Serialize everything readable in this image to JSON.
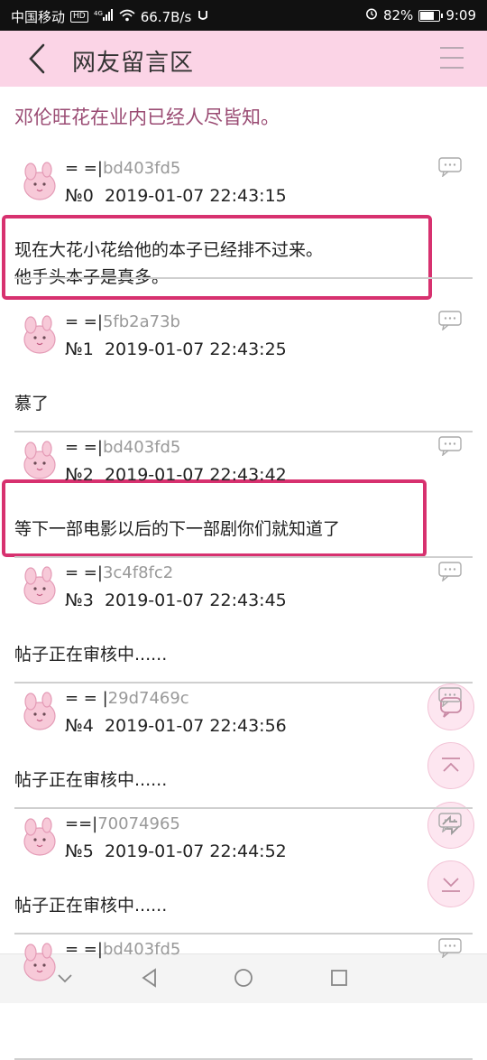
{
  "status_bar": {
    "carrier": "中国移动",
    "hd": "HD",
    "signal": "4G",
    "speed": "66.7B/s",
    "battery_pct": "82%",
    "battery_level": 0.82,
    "time": "9:09"
  },
  "header": {
    "title": "网友留言区"
  },
  "topic": "邓伦旺花在业内已经人尽皆知。",
  "posts": [
    {
      "user_prefix": "= =|",
      "user_hash": "bd403fd5",
      "floor": "№0",
      "timestamp": "2019-01-07 22:43:15",
      "body": "现在大花小花给他的本子已经排不过来。\n他手头本子是真多。"
    },
    {
      "user_prefix": "= =|",
      "user_hash": "5fb2a73b",
      "floor": "№1",
      "timestamp": "2019-01-07 22:43:25",
      "body": "慕了"
    },
    {
      "user_prefix": "= =|",
      "user_hash": "bd403fd5",
      "floor": "№2",
      "timestamp": "2019-01-07 22:43:42",
      "body": "等下一部电影以后的下一部剧你们就知道了"
    },
    {
      "user_prefix": "= =|",
      "user_hash": "3c4f8fc2",
      "floor": "№3",
      "timestamp": "2019-01-07 22:43:45",
      "body": "帖子正在审核中......"
    },
    {
      "user_prefix": "= = |",
      "user_hash": "29d7469c",
      "floor": "№4",
      "timestamp": "2019-01-07 22:43:56",
      "body": "帖子正在审核中......"
    },
    {
      "user_prefix": "==|",
      "user_hash": "70074965",
      "floor": "№5",
      "timestamp": "2019-01-07 22:44:52",
      "body": "帖子正在审核中......"
    },
    {
      "user_prefix": "= =|",
      "user_hash": "bd403fd5",
      "floor": "",
      "timestamp": "",
      "body": ""
    }
  ],
  "colors": {
    "header_bg": "#fbd4e6",
    "topic_text": "#9a4b73",
    "highlight": "#d7316f",
    "fab_bg": "#fde6f0"
  },
  "icons": {
    "back": "chevron-left-icon",
    "menu": "hamburger-menu-icon",
    "reply": "comment-bubble-icon",
    "fab_comment": "comment-icon",
    "fab_top": "scroll-top-icon",
    "fab_refresh": "refresh-icon",
    "fab_bottom": "scroll-bottom-icon"
  }
}
